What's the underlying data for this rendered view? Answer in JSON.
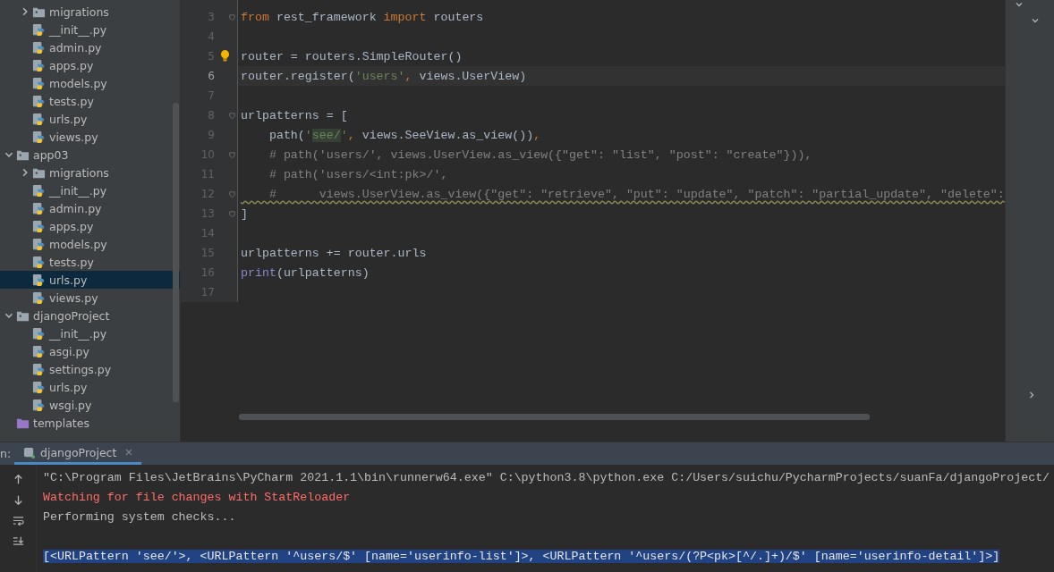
{
  "project_tree": {
    "cut_parent_children": [
      {
        "label": "migrations",
        "kind": "folder",
        "expanded": false,
        "selected": false
      },
      {
        "label": "__init__.py",
        "kind": "python",
        "selected": false
      },
      {
        "label": "admin.py",
        "kind": "python",
        "selected": false
      },
      {
        "label": "apps.py",
        "kind": "python",
        "selected": false
      },
      {
        "label": "models.py",
        "kind": "python",
        "selected": false
      },
      {
        "label": "tests.py",
        "kind": "python",
        "selected": false
      },
      {
        "label": "urls.py",
        "kind": "python",
        "selected": false
      },
      {
        "label": "views.py",
        "kind": "python",
        "selected": false
      }
    ],
    "items": [
      {
        "label": "app03",
        "kind": "folder",
        "expanded": true,
        "selected": false,
        "children": [
          {
            "label": "migrations",
            "kind": "folder",
            "expanded": false,
            "selected": false
          },
          {
            "label": "__init__.py",
            "kind": "python",
            "selected": false
          },
          {
            "label": "admin.py",
            "kind": "python",
            "selected": false
          },
          {
            "label": "apps.py",
            "kind": "python",
            "selected": false
          },
          {
            "label": "models.py",
            "kind": "python",
            "selected": false
          },
          {
            "label": "tests.py",
            "kind": "python",
            "selected": false
          },
          {
            "label": "urls.py",
            "kind": "python",
            "selected": true
          },
          {
            "label": "views.py",
            "kind": "python",
            "selected": false
          }
        ]
      },
      {
        "label": "djangoProject",
        "kind": "folder",
        "expanded": true,
        "selected": false,
        "children": [
          {
            "label": "__init__.py",
            "kind": "python",
            "selected": false
          },
          {
            "label": "asgi.py",
            "kind": "python",
            "selected": false
          },
          {
            "label": "settings.py",
            "kind": "python",
            "selected": false
          },
          {
            "label": "urls.py",
            "kind": "python",
            "selected": false
          },
          {
            "label": "wsgi.py",
            "kind": "python",
            "selected": false
          }
        ]
      },
      {
        "label": "templates",
        "kind": "templates",
        "selected": false
      }
    ]
  },
  "editor": {
    "lines": [
      {
        "number": "3",
        "fold": true,
        "tokens": [
          {
            "kind": "kw",
            "text": "from"
          },
          {
            "kind": "plain",
            "text": " rest_framework "
          },
          {
            "kind": "kw",
            "text": "import"
          },
          {
            "kind": "plain",
            "text": " routers"
          }
        ]
      },
      {
        "number": "4"
      },
      {
        "number": "5",
        "bulb": true,
        "tokens": [
          {
            "kind": "plain",
            "text": "router = routers.SimpleRouter()"
          }
        ]
      },
      {
        "number": "6",
        "current": true,
        "tokens": [
          {
            "kind": "plain",
            "text": "router.register("
          },
          {
            "kind": "str",
            "text": "'users'"
          },
          {
            "kind": "kw",
            "text": ","
          },
          {
            "kind": "plain",
            "text": " views.UserView)"
          }
        ]
      },
      {
        "number": "7"
      },
      {
        "number": "8",
        "fold": true,
        "tokens": [
          {
            "kind": "plain",
            "text": "urlpatterns = ["
          }
        ]
      },
      {
        "number": "9",
        "tokens": [
          {
            "kind": "plain",
            "text": "    path("
          },
          {
            "kind": "str",
            "text": "'"
          },
          {
            "kind": "match",
            "text": "see/"
          },
          {
            "kind": "str",
            "text": "'"
          },
          {
            "kind": "kw",
            "text": ","
          },
          {
            "kind": "plain",
            "text": " views.SeeView.as_view())"
          },
          {
            "kind": "kw",
            "text": ","
          }
        ]
      },
      {
        "number": "10",
        "fold": true,
        "tokens": [
          {
            "kind": "comment",
            "text": "    # path('users/', views.UserView.as_view({\"get\": \"list\", \"post\": \"create\"})),"
          }
        ]
      },
      {
        "number": "11",
        "tokens": [
          {
            "kind": "comment",
            "text": "    # path('users/<int:pk>/',"
          }
        ]
      },
      {
        "number": "12",
        "fold": true,
        "warning": true,
        "tokens": [
          {
            "kind": "comment",
            "text": "    #      views.UserView.as_view({\"get\": \"retrieve\", \"put\": \"update\", \"patch\": \"partial_update\", \"delete\":"
          }
        ]
      },
      {
        "number": "13",
        "fold": true,
        "tokens": [
          {
            "kind": "plain",
            "text": "]"
          }
        ]
      },
      {
        "number": "14"
      },
      {
        "number": "15",
        "tokens": [
          {
            "kind": "plain",
            "text": "urlpatterns += router.urls"
          }
        ]
      },
      {
        "number": "16",
        "tokens": [
          {
            "kind": "builtin",
            "text": "print"
          },
          {
            "kind": "plain",
            "text": "(urlpatterns)"
          }
        ]
      },
      {
        "number": "17"
      }
    ]
  },
  "run_panel": {
    "label": "n:",
    "tabs": [
      {
        "label": "djangoProject",
        "selected": true
      }
    ],
    "console": [
      {
        "kind": "normal",
        "selected": false,
        "text": "\"C:\\Program Files\\JetBrains\\PyCharm 2021.1.1\\bin\\runnerw64.exe\" C:\\python3.8\\python.exe C:/Users/suichu/PycharmProjects/suanFa/djangoProject/"
      },
      {
        "kind": "error",
        "selected": false,
        "text": "Watching for file changes with StatReloader"
      },
      {
        "kind": "normal",
        "selected": false,
        "text": "Performing system checks..."
      },
      {
        "kind": "blank",
        "selected": false
      },
      {
        "kind": "normal",
        "selected": true,
        "text": "[<URLPattern 'see/'>, <URLPattern '^users/$' [name='userinfo-list']>, <URLPattern '^users/(?P<pk>[^/.]+)/$' [name='userinfo-detail']>]"
      }
    ]
  }
}
